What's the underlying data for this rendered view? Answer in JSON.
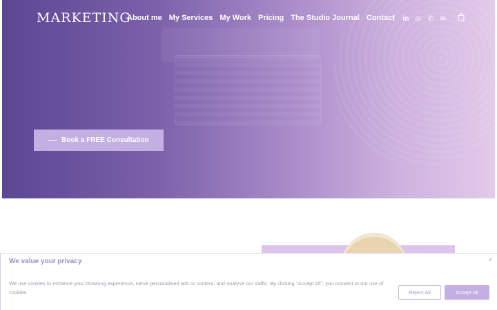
{
  "header": {
    "logo_text": "MARKETING",
    "nav": [
      {
        "label": "About me"
      },
      {
        "label": "My Services"
      },
      {
        "label": "My Work"
      },
      {
        "label": "Pricing"
      },
      {
        "label": "The Studio Journal"
      },
      {
        "label": "Contact"
      }
    ],
    "social_icons": [
      {
        "name": "facebook-icon",
        "glyph": "f"
      },
      {
        "name": "linkedin-icon",
        "glyph": "in"
      },
      {
        "name": "instagram-icon",
        "glyph": "◎"
      },
      {
        "name": "phone-icon",
        "glyph": "✆"
      },
      {
        "name": "email-icon",
        "glyph": "✉"
      }
    ],
    "cart_icon": "shopping-bag-icon"
  },
  "hero": {
    "cta_label": "Book a FREE Consultation"
  },
  "cookie_banner": {
    "title": "We value your privacy",
    "text": "We use cookies to enhance your browsing experience, serve personalised ads or content, and analyse our traffic. By clicking \"Accept All\", you consent to our use of cookies.",
    "close_glyph": "×",
    "reject_label": "Reject All",
    "accept_label": "Accept All"
  },
  "colors": {
    "accent": "#c3afe2",
    "hero_start": "#5b4793",
    "hero_end": "#e3caea"
  }
}
